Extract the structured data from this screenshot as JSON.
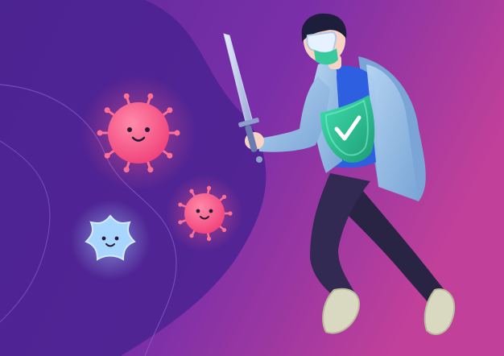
{
  "illustration": {
    "elements": [
      {
        "name": "background",
        "shape": "purple gradient backdrop"
      },
      {
        "name": "virus-large",
        "shape": "pink smiling virus"
      },
      {
        "name": "virus-small",
        "shape": "pink smiling virus"
      },
      {
        "name": "germ-star",
        "shape": "light blue star-shaped germ"
      },
      {
        "name": "doctor",
        "shape": "person in lab coat with face mask and goggles"
      },
      {
        "name": "sword",
        "shape": "steel sword"
      },
      {
        "name": "shield",
        "shape": "green shield with white check mark"
      }
    ]
  },
  "colors": {
    "bg_start": "#5b2a9c",
    "bg_end": "#c0409a",
    "blob": "#4a2290",
    "virus": "#ff5c8a",
    "virus_light": "#ff8aa8",
    "germ": "#9fd0ff",
    "coat": "#9fc4e8",
    "coat_shadow": "#7aa5d6",
    "shirt": "#2d5fe0",
    "pants": "#2a2444",
    "shield": "#2cc295",
    "shield_dark": "#1e9b75",
    "mask": "#39c99d",
    "skin": "#f7d3c4",
    "hair": "#1d1d3c",
    "shoe": "#d9d9c2"
  },
  "icons": [
    "check-icon"
  ]
}
